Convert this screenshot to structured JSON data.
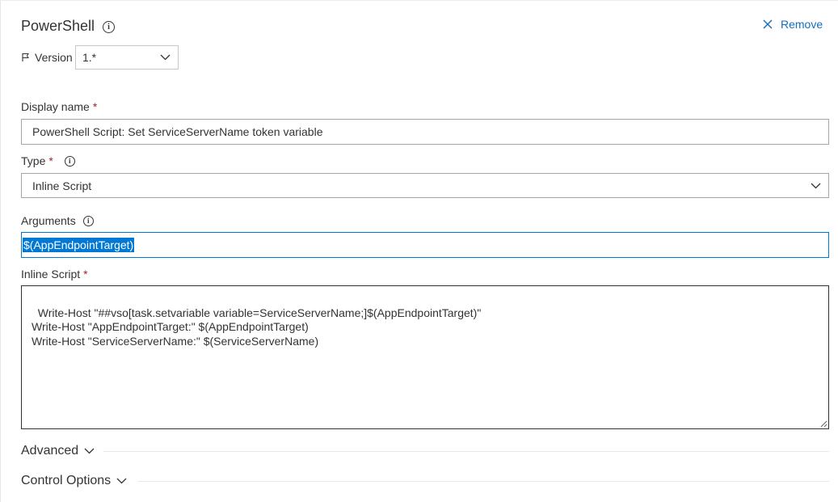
{
  "task": {
    "title": "PowerShell",
    "remove_label": "Remove"
  },
  "version": {
    "label": "Version",
    "value": "1.*"
  },
  "fields": {
    "display_name": {
      "label": "Display name",
      "required_mark": "*",
      "value": "PowerShell Script: Set ServiceServerName token variable"
    },
    "type": {
      "label": "Type",
      "required_mark": "*",
      "value": "Inline Script"
    },
    "arguments": {
      "label": "Arguments",
      "value": "$(AppEndpointTarget)"
    },
    "inline_script": {
      "label": "Inline Script",
      "required_mark": "*",
      "value": "Write-Host \"##vso[task.setvariable variable=ServiceServerName;]$(AppEndpointTarget)\"\nWrite-Host \"AppEndpointTarget:\" $(AppEndpointTarget)\nWrite-Host \"ServiceServerName:\" $(ServiceServerName)"
    }
  },
  "sections": {
    "advanced": "Advanced",
    "control_options": "Control Options"
  },
  "icons": {
    "info": "info-icon",
    "remove": "close-icon",
    "version": "flag-icon",
    "dropdown": "chevron-down-icon"
  },
  "colors": {
    "accent": "#0078d4",
    "link": "#106ebe",
    "required": "#a4262c"
  }
}
